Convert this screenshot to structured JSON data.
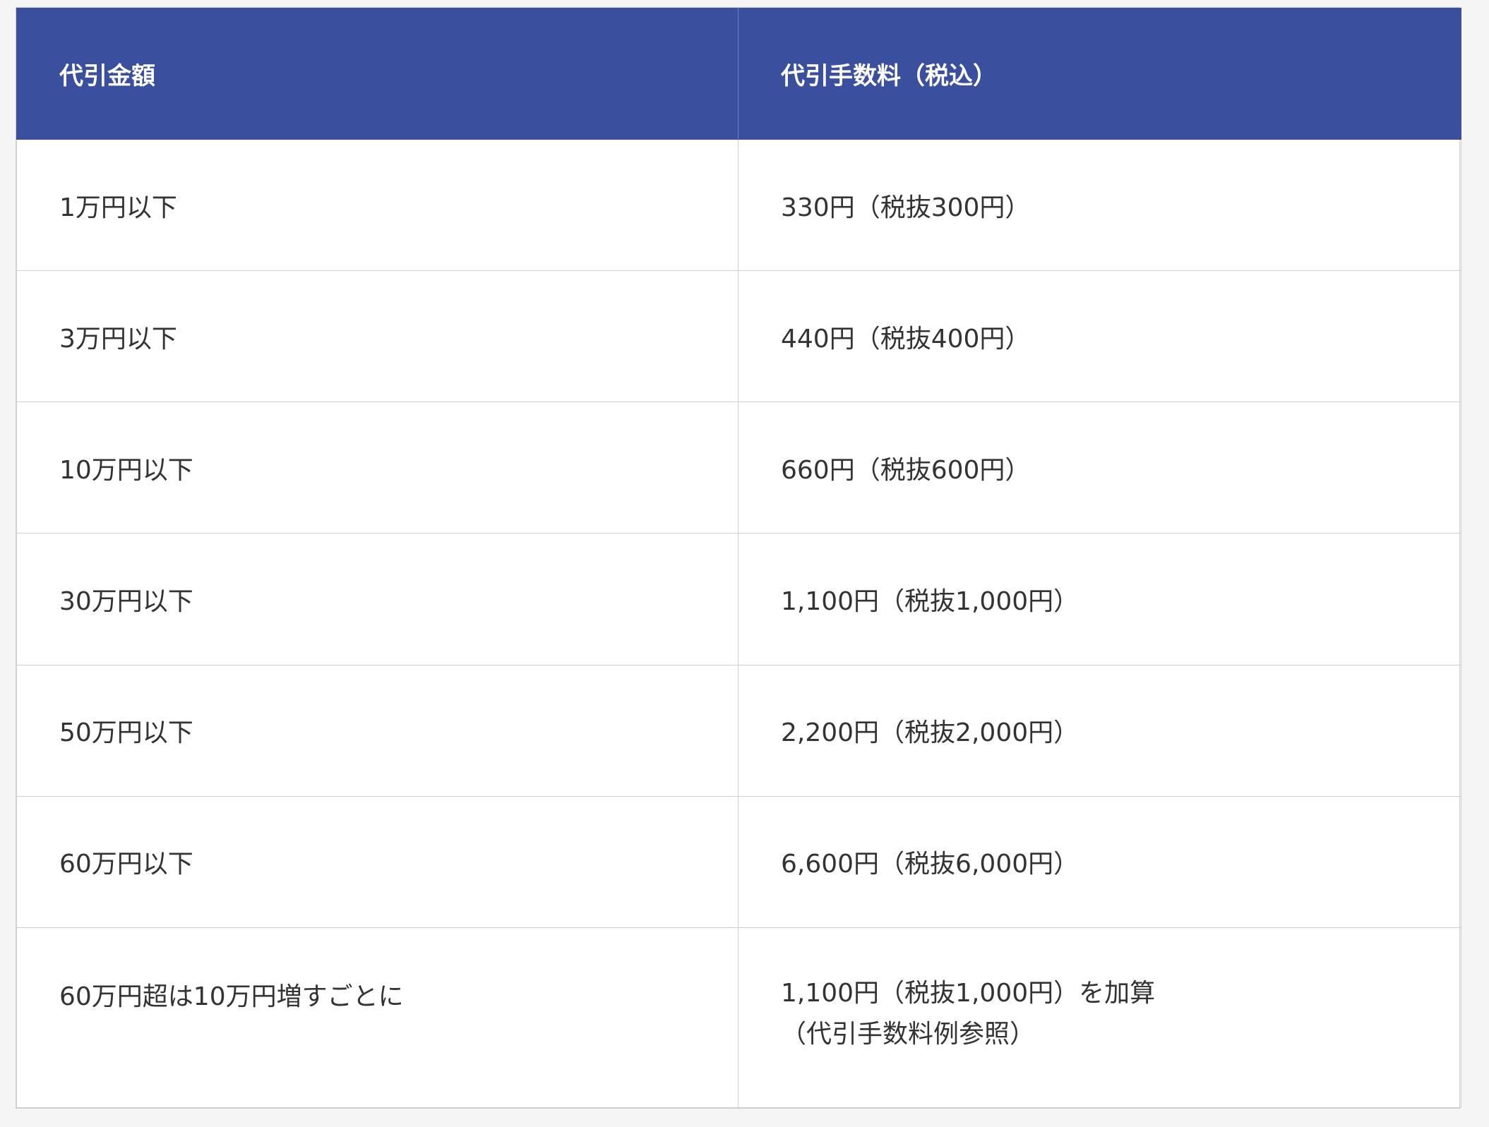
{
  "table": {
    "headers": [
      "代引金額",
      "代引手数料（税込）"
    ],
    "rows": [
      {
        "amount": "1万円以下",
        "fee": "330円（税抜300円）"
      },
      {
        "amount": "3万円以下",
        "fee": "440円（税抜400円）"
      },
      {
        "amount": "10万円以下",
        "fee": "660円（税抜600円）"
      },
      {
        "amount": "30万円以下",
        "fee": "1,100円（税抜1,000円）"
      },
      {
        "amount": "50万円以下",
        "fee": "2,200円（税抜2,000円）"
      },
      {
        "amount": "60万円以下",
        "fee": "6,600円（税抜6,000円）"
      },
      {
        "amount": "60万円超は10万円増すごとに",
        "fee": "1,100円（税抜1,000円）を加算",
        "note": "（代引手数料例参照）"
      }
    ]
  },
  "colors": {
    "header_bg": "#3a4f9e",
    "header_text": "#ffffff",
    "body_text": "#333333",
    "border": "#cfcfcf",
    "page_bg": "#f5f5f5"
  }
}
